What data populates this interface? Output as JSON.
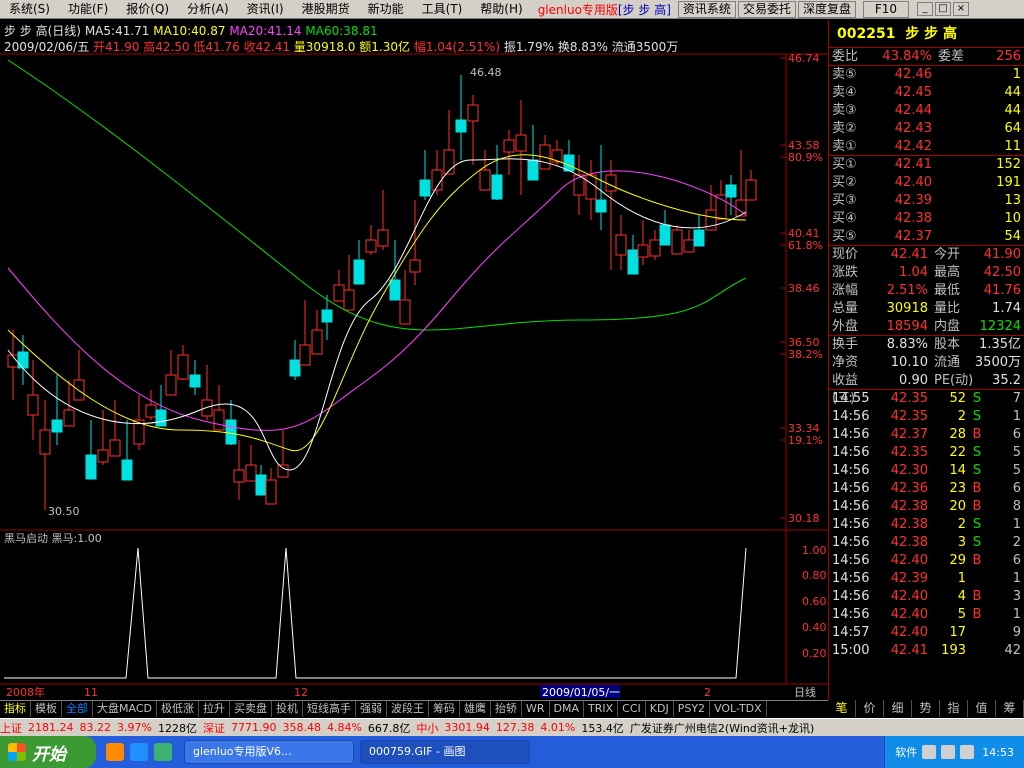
{
  "menu": {
    "items": [
      "系统(S)",
      "功能(F)",
      "报价(Q)",
      "分析(A)",
      "资讯(I)",
      "港股期货",
      "新功能",
      "工具(T)",
      "帮助(H)"
    ],
    "brand": "glenluo专用版",
    "stock_title": "[步 步 高]",
    "buttons": [
      "资讯系统",
      "交易委托",
      "深度复盘"
    ],
    "f10": "F10"
  },
  "header": {
    "name": "步 步 高(日线)",
    "ma5": "MA5:41.71",
    "ma10": "MA10:40.87",
    "ma20": "MA20:41.14",
    "ma60": "MA60:38.81",
    "date": "2009/02/06/五",
    "open": "开41.90",
    "high": "高42.50",
    "low": "低41.76",
    "close": "收42.41",
    "volume": "量30918.0",
    "amount": "额1.30亿",
    "change": "幅1.04(2.51%)",
    "amplitude": "振1.79%",
    "turnover": "换8.83%",
    "float": "流通3500万"
  },
  "price_axis": [
    "46.74",
    "43.58",
    "80.9%",
    "40.41",
    "61.8%",
    "38.46",
    "36.50",
    "38.2%",
    "33.34",
    "19.1%",
    "30.18"
  ],
  "annotations": {
    "high": "46.48",
    "low": "30.50"
  },
  "indicator": {
    "label": "黑马启动",
    "value": "黑马:1.00",
    "axis": [
      "1.00",
      "0.80",
      "0.60",
      "0.40",
      "0.20"
    ]
  },
  "date_axis": [
    "2008年",
    "11",
    "12",
    "2009/01/05/一",
    "2",
    "日线"
  ],
  "quote": {
    "code": "002251",
    "name": "步 步 高",
    "weibi_label": "委比",
    "weibi": "43.84%",
    "weicha_label": "委差",
    "weicha": "256",
    "asks": [
      {
        "label": "卖⑤",
        "price": "42.46",
        "vol": "1"
      },
      {
        "label": "卖④",
        "price": "42.45",
        "vol": "44"
      },
      {
        "label": "卖③",
        "price": "42.44",
        "vol": "44"
      },
      {
        "label": "卖②",
        "price": "42.43",
        "vol": "64"
      },
      {
        "label": "卖①",
        "price": "42.42",
        "vol": "11"
      }
    ],
    "bids": [
      {
        "label": "买①",
        "price": "42.41",
        "vol": "152"
      },
      {
        "label": "买②",
        "price": "42.40",
        "vol": "191"
      },
      {
        "label": "买③",
        "price": "42.39",
        "vol": "13"
      },
      {
        "label": "买④",
        "price": "42.38",
        "vol": "10"
      },
      {
        "label": "买⑤",
        "price": "42.37",
        "vol": "54"
      }
    ],
    "stats": [
      {
        "k1": "现价",
        "v1": "42.41",
        "k2": "今开",
        "v2": "41.90"
      },
      {
        "k1": "涨跌",
        "v1": "1.04",
        "k2": "最高",
        "v2": "42.50"
      },
      {
        "k1": "涨幅",
        "v1": "2.51%",
        "k2": "最低",
        "v2": "41.76"
      },
      {
        "k1": "总量",
        "v1": "30918",
        "k2": "量比",
        "v2": "1.74"
      },
      {
        "k1": "外盘",
        "v1": "18594",
        "k2": "内盘",
        "v2": "12324"
      }
    ],
    "stats2": [
      {
        "k1": "换手",
        "v1": "8.83%",
        "k2": "股本",
        "v2": "1.35亿"
      },
      {
        "k1": "净资",
        "v1": "10.10",
        "k2": "流通",
        "v2": "3500万"
      },
      {
        "k1": "收益(三)",
        "v1": "0.90",
        "k2": "PE(动)",
        "v2": "35.2"
      }
    ]
  },
  "ticks": [
    {
      "t": "14:55",
      "p": "42.35",
      "v": "52",
      "bs": "S",
      "n": "7"
    },
    {
      "t": "14:56",
      "p": "42.35",
      "v": "2",
      "bs": "S",
      "n": "1"
    },
    {
      "t": "14:56",
      "p": "42.37",
      "v": "28",
      "bs": "B",
      "n": "6"
    },
    {
      "t": "14:56",
      "p": "42.35",
      "v": "22",
      "bs": "S",
      "n": "5"
    },
    {
      "t": "14:56",
      "p": "42.30",
      "v": "14",
      "bs": "S",
      "n": "5"
    },
    {
      "t": "14:56",
      "p": "42.36",
      "v": "23",
      "bs": "B",
      "n": "6"
    },
    {
      "t": "14:56",
      "p": "42.38",
      "v": "20",
      "bs": "B",
      "n": "8"
    },
    {
      "t": "14:56",
      "p": "42.38",
      "v": "2",
      "bs": "S",
      "n": "1"
    },
    {
      "t": "14:56",
      "p": "42.38",
      "v": "3",
      "bs": "S",
      "n": "2"
    },
    {
      "t": "14:56",
      "p": "42.40",
      "v": "29",
      "bs": "B",
      "n": "6"
    },
    {
      "t": "14:56",
      "p": "42.39",
      "v": "1",
      "bs": "",
      "n": "1"
    },
    {
      "t": "14:56",
      "p": "42.40",
      "v": "4",
      "bs": "B",
      "n": "3"
    },
    {
      "t": "14:56",
      "p": "42.40",
      "v": "5",
      "bs": "B",
      "n": "1"
    },
    {
      "t": "14:57",
      "p": "42.40",
      "v": "17",
      "bs": "",
      "n": "9"
    },
    {
      "t": "15:00",
      "p": "42.41",
      "v": "193",
      "bs": "",
      "n": "42"
    }
  ],
  "bottom_tabs": [
    "指标",
    "模板",
    "全部",
    "大盘MACD",
    "极低涨",
    "拉升",
    "买卖盘",
    "投机",
    "短线高手",
    "强弱",
    "波段王",
    "筹码",
    "雄鹰",
    "抬轿",
    "WR",
    "DMA",
    "TRIX",
    "CCI",
    "KDJ",
    "PSY2",
    "VOL-TDX"
  ],
  "right_tabs": [
    "笔",
    "价",
    "细",
    "势",
    "指",
    "值",
    "筹"
  ],
  "status": [
    "上证",
    "2181.24",
    "83.22",
    "3.97%",
    "1228亿",
    "深证",
    "7771.90",
    "358.48",
    "4.84%",
    "667.8亿",
    "中小",
    "3301.94",
    "127.38",
    "4.01%",
    "153.4亿",
    "广发证券广州电信2(Wind资讯+龙讯)"
  ],
  "taskbar": {
    "start": "开始",
    "tasks": [
      "glenluo专用版V6...",
      "000759.GIF - 画图"
    ],
    "tray_label": "软件",
    "time": "14:53"
  },
  "colors": {
    "up": "#ff3030",
    "down": "#00e0e0",
    "ma5": "#ffffff",
    "ma10": "#ffff00",
    "ma20": "#ff40ff",
    "ma60": "#00e000"
  }
}
